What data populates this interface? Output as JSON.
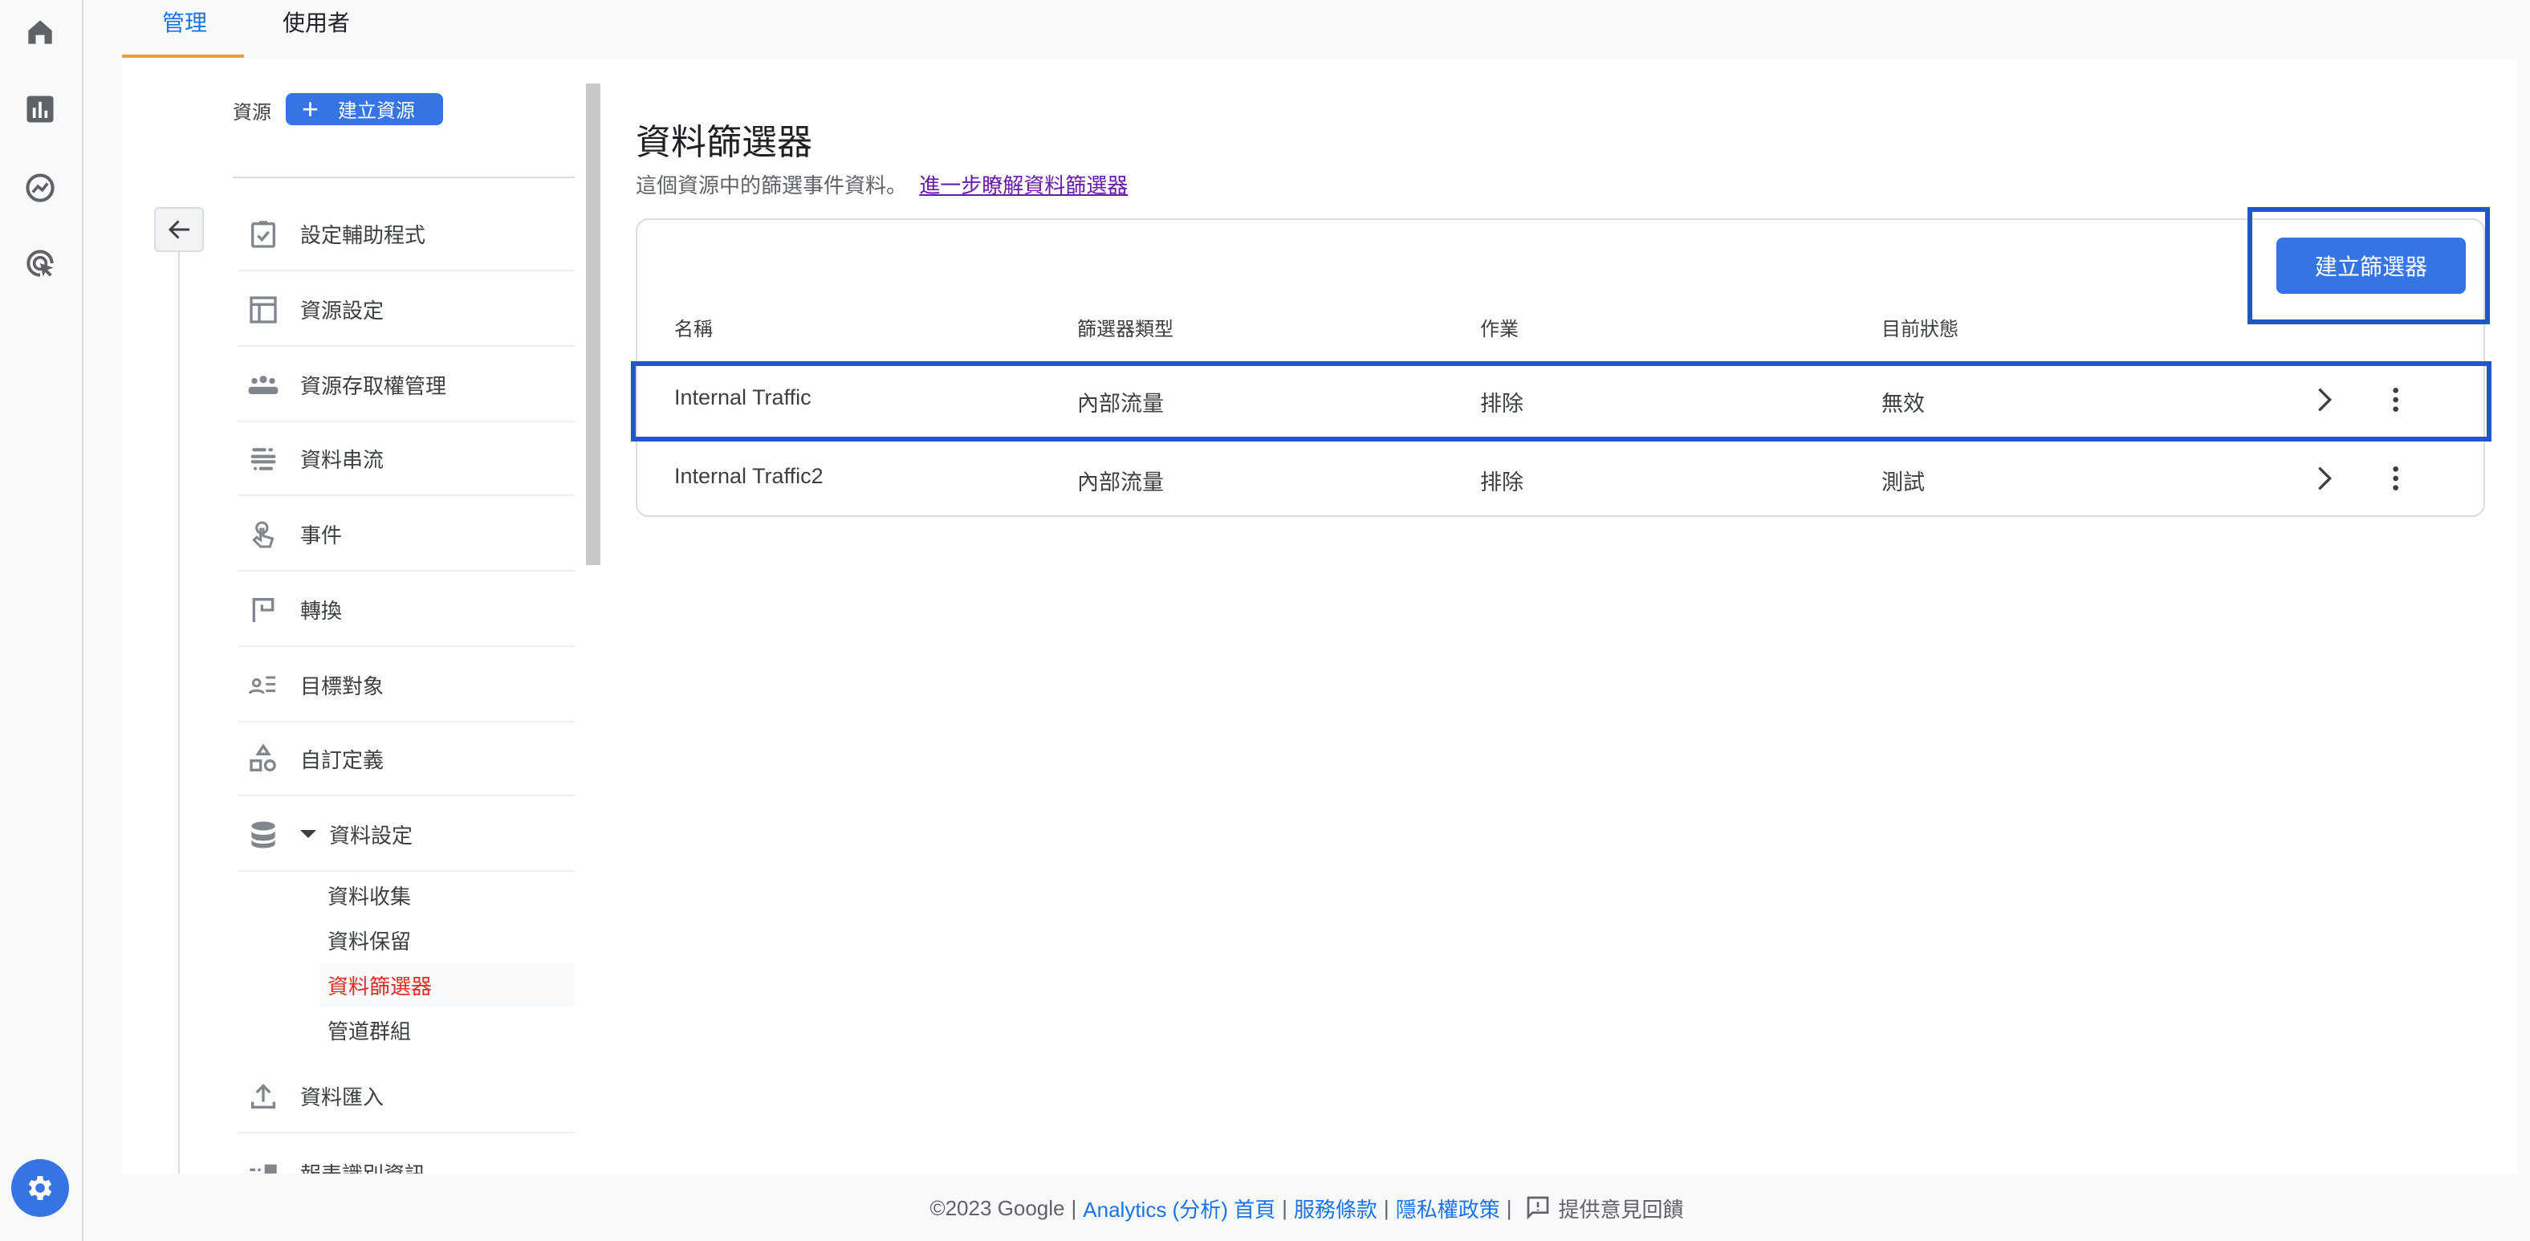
{
  "rail": {
    "icons": [
      "home-icon",
      "reports-icon",
      "explore-icon",
      "advertising-icon"
    ],
    "settings_icon": "gear-icon"
  },
  "tabs": [
    {
      "label": "管理",
      "active": true
    },
    {
      "label": "使用者",
      "active": false
    }
  ],
  "property": {
    "label": "資源",
    "create_button": "建立資源"
  },
  "menu": {
    "items": [
      {
        "label": "設定輔助程式",
        "icon": "clipboard-check-icon"
      },
      {
        "label": "資源設定",
        "icon": "layout-icon"
      },
      {
        "label": "資源存取權管理",
        "icon": "people-icon"
      },
      {
        "label": "資料串流",
        "icon": "streams-icon"
      },
      {
        "label": "事件",
        "icon": "touch-icon"
      },
      {
        "label": "轉換",
        "icon": "flag-icon"
      },
      {
        "label": "目標對象",
        "icon": "audience-icon"
      },
      {
        "label": "自訂定義",
        "icon": "shapes-icon"
      },
      {
        "label": "資料設定",
        "icon": "database-icon",
        "expanded": true
      }
    ],
    "sub_items": [
      {
        "label": "資料收集",
        "active": false
      },
      {
        "label": "資料保留",
        "active": false
      },
      {
        "label": "資料篩選器",
        "active": true
      },
      {
        "label": "管道群組",
        "active": false
      }
    ],
    "after": [
      {
        "label": "資料匯入",
        "icon": "upload-icon"
      },
      {
        "label": "報表識別資訊",
        "icon": "reporting-identity-icon"
      }
    ]
  },
  "main": {
    "title": "資料篩選器",
    "subtitle": "這個資源中的篩選事件資料。",
    "learn_more": "進一步瞭解資料篩選器",
    "create_button": "建立篩選器",
    "columns": [
      "名稱",
      "篩選器類型",
      "作業",
      "目前狀態"
    ],
    "rows": [
      {
        "name": "Internal Traffic",
        "type": "內部流量",
        "operation": "排除",
        "state": "無效"
      },
      {
        "name": "Internal Traffic2",
        "type": "內部流量",
        "operation": "排除",
        "state": "測試"
      }
    ]
  },
  "footer": {
    "copyright": "©2023 Google",
    "sep": "|",
    "links": [
      "Analytics (分析) 首頁",
      "服務條款",
      "隱私權政策"
    ],
    "feedback": "提供意見回饋"
  },
  "colors": {
    "accent": "#3574e2",
    "highlight": "#1f57c7",
    "active_tab_underline": "#f29a38",
    "active_item": "#d93025"
  }
}
